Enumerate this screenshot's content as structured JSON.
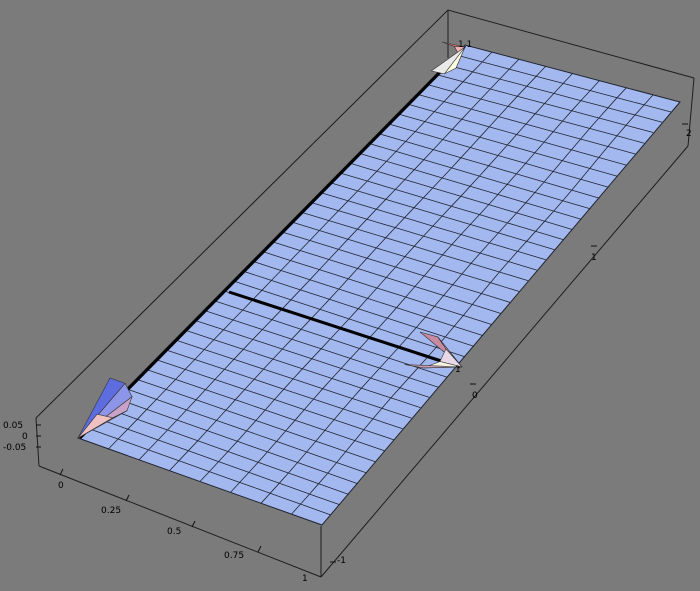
{
  "background": "#7b7b7b",
  "surface": {
    "fill": "#a3b8ef",
    "mesh": "#1f2430",
    "grid_rows": 40,
    "grid_cols": 8
  },
  "axes": {
    "z_ticks": [
      "0.05",
      "0",
      "-0.05"
    ],
    "x_ticks": [
      "0",
      "0.25",
      "0.5",
      "0.75",
      "1"
    ],
    "y_ticks": [
      "-1",
      "0",
      "1",
      "2"
    ]
  },
  "labels": {
    "top_marker": "1,1",
    "mid_marker": "1"
  },
  "cones": [
    {
      "name": "left-cone",
      "colors": [
        "#5d6de0",
        "#8d95e8",
        "#c9a3c7",
        "#e7a6a6",
        "#f0c1c1"
      ]
    },
    {
      "name": "right-cone",
      "colors": [
        "#c78aa0",
        "#d8a0b8",
        "#e8d8e8",
        "#f3f3e0",
        "#c6a0b6"
      ]
    },
    {
      "name": "top-cone",
      "colors": [
        "#e87878",
        "#f2b0b0",
        "#f7e8c8",
        "#ffffe0",
        "#e9e9e9"
      ]
    }
  ]
}
